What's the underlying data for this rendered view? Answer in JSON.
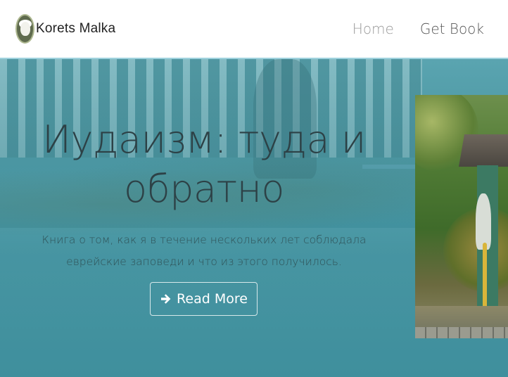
{
  "navbar": {
    "brand": "Korets Malka",
    "links": [
      {
        "label": "Home"
      },
      {
        "label": "Get Book"
      }
    ]
  },
  "hero": {
    "title": "Иудаизм: туда и обратно",
    "subtitle": "Книга о том, как я в течение нескольких лет соблюдала еврейские заповеди и что из этого получилось.",
    "button_label": "Read More",
    "button_icon": "arrow-right-icon"
  },
  "colors": {
    "hero_overlay": "#3f8f9d",
    "navbar_bg": "#ffffff",
    "title_text": "#2d4146",
    "button_text": "#ffffff"
  }
}
